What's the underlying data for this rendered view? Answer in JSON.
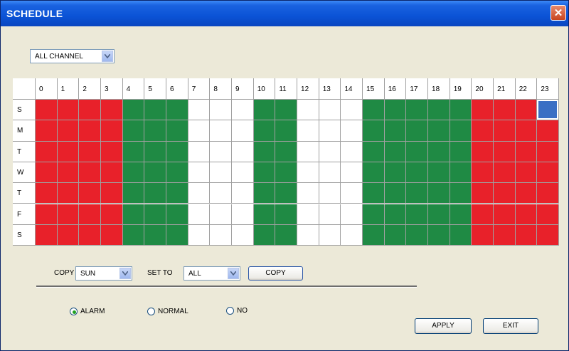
{
  "window": {
    "title": "SCHEDULE"
  },
  "channel_select": {
    "value": "ALL CHANNEL"
  },
  "hours": [
    "0",
    "1",
    "2",
    "3",
    "4",
    "5",
    "6",
    "7",
    "8",
    "9",
    "10",
    "11",
    "12",
    "13",
    "14",
    "15",
    "16",
    "17",
    "18",
    "19",
    "20",
    "21",
    "22",
    "23"
  ],
  "days": [
    "S",
    "M",
    "T",
    "W",
    "T",
    "F",
    "S"
  ],
  "legend_colors": {
    "alarm": "#e8212a",
    "normal": "#1f8a44",
    "no": "#ffffff",
    "selected": "#3a6fc4"
  },
  "schedule_row_pattern": [
    "alarm",
    "alarm",
    "alarm",
    "alarm",
    "normal",
    "normal",
    "normal",
    "no",
    "no",
    "no",
    "normal",
    "normal",
    "no",
    "no",
    "no",
    "normal",
    "normal",
    "normal",
    "normal",
    "normal",
    "alarm",
    "alarm",
    "alarm",
    "alarm"
  ],
  "selected_cell": {
    "day": "S",
    "hour": "23"
  },
  "copy_bar": {
    "copy_label": "COPY",
    "from_value": "SUN",
    "set_to_label": "SET TO",
    "to_value": "ALL",
    "copy_button": "COPY"
  },
  "modes": {
    "options": [
      "ALARM",
      "NORMAL",
      "NO"
    ],
    "selected": "ALARM"
  },
  "buttons": {
    "apply": "APPLY",
    "exit": "EXIT"
  }
}
